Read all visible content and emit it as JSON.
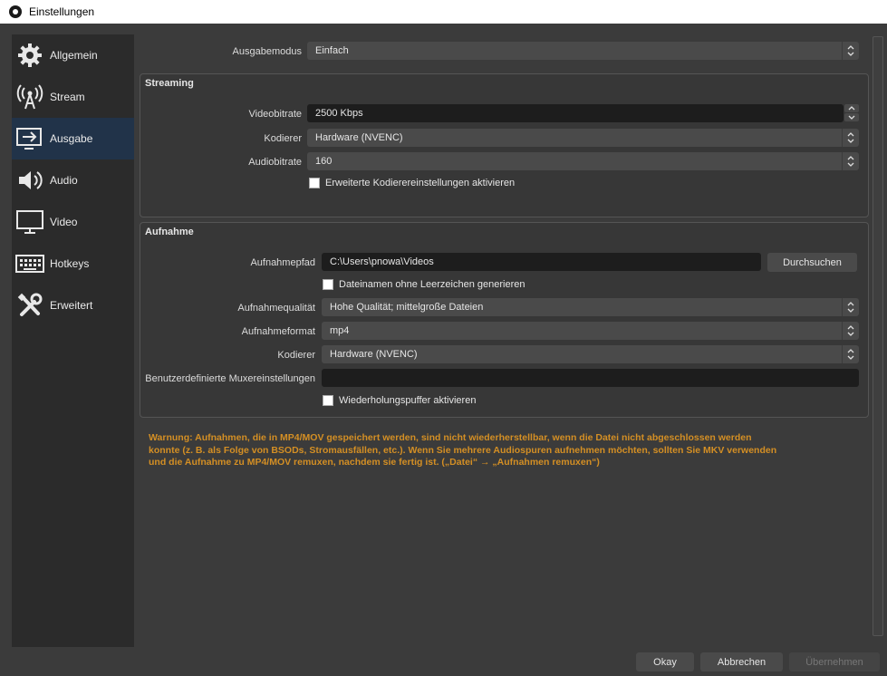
{
  "window": {
    "title": "Einstellungen"
  },
  "sidebar": {
    "items": [
      {
        "label": "Allgemein",
        "icon": "gear-icon"
      },
      {
        "label": "Stream",
        "icon": "antenna-icon"
      },
      {
        "label": "Ausgabe",
        "icon": "output-icon",
        "active": true
      },
      {
        "label": "Audio",
        "icon": "speaker-icon"
      },
      {
        "label": "Video",
        "icon": "monitor-icon"
      },
      {
        "label": "Hotkeys",
        "icon": "keyboard-icon"
      },
      {
        "label": "Erweitert",
        "icon": "tools-icon"
      }
    ]
  },
  "output_mode": {
    "label": "Ausgabemodus",
    "value": "Einfach"
  },
  "streaming": {
    "title": "Streaming",
    "video_bitrate": {
      "label": "Videobitrate",
      "value": "2500 Kbps"
    },
    "encoder": {
      "label": "Kodierer",
      "value": "Hardware (NVENC)"
    },
    "audio_bitrate": {
      "label": "Audiobitrate",
      "value": "160"
    },
    "advanced_checkbox": {
      "label": "Erweiterte Kodierereinstellungen aktivieren",
      "checked": false
    }
  },
  "recording": {
    "title": "Aufnahme",
    "path": {
      "label": "Aufnahmepfad",
      "value": "C:\\Users\\pnowa\\Videos",
      "browse_label": "Durchsuchen"
    },
    "no_space_checkbox": {
      "label": "Dateinamen ohne Leerzeichen generieren",
      "checked": false
    },
    "quality": {
      "label": "Aufnahmequalität",
      "value": "Hohe Qualität; mittelgroße Dateien"
    },
    "format": {
      "label": "Aufnahmeformat",
      "value": "mp4"
    },
    "encoder": {
      "label": "Kodierer",
      "value": "Hardware (NVENC)"
    },
    "muxer": {
      "label": "Benutzerdefinierte Muxereinstellungen",
      "value": ""
    },
    "replay_checkbox": {
      "label": "Wiederholungspuffer aktivieren",
      "checked": false
    }
  },
  "warning": {
    "line1": "Warnung: Aufnahmen, die in MP4/MOV gespeichert werden, sind nicht wiederherstellbar, wenn die Datei nicht abgeschlossen werden",
    "line2": "konnte (z. B. als Folge von BSODs, Stromausfällen, etc.). Wenn Sie mehrere Audiospuren aufnehmen möchten, sollten Sie MKV verwenden",
    "line3": "und die Aufnahme zu MP4/MOV remuxen, nachdem sie fertig ist. („Datei“ → „Aufnahmen remuxen“)",
    "color": "#d48f24"
  },
  "footer": {
    "okay": "Okay",
    "cancel": "Abbrechen",
    "apply": "Übernehmen"
  },
  "colors": {
    "accent_active": "#213349",
    "background": "#3b3b3b",
    "sidebar": "#2b2b2b"
  }
}
